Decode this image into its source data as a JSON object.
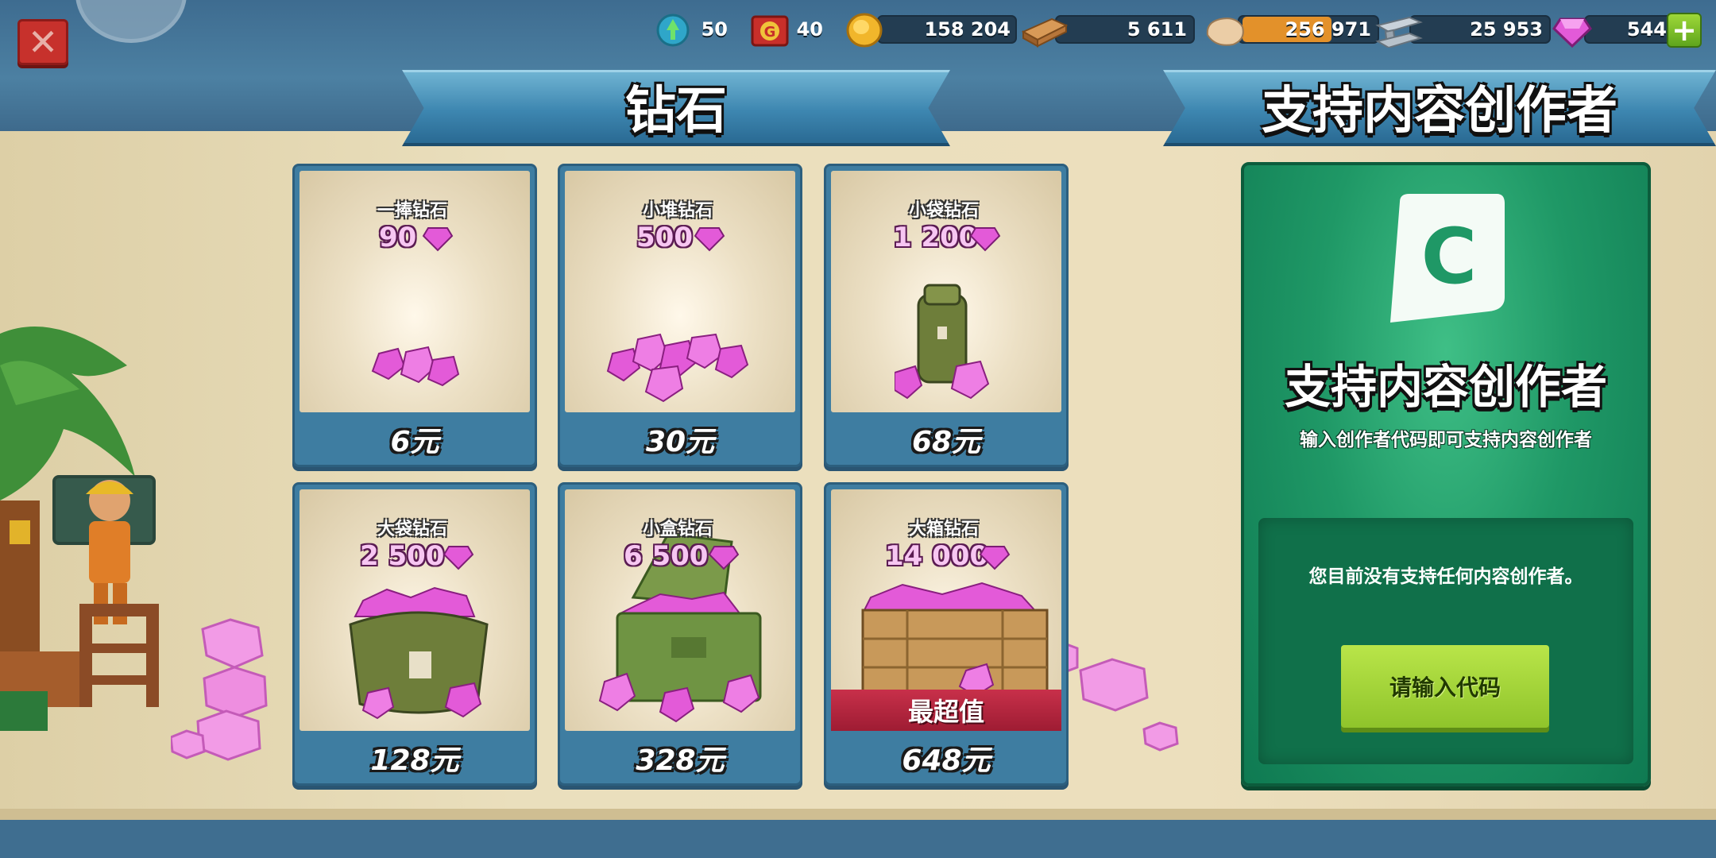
{
  "header": {
    "close_glyph": "✕",
    "resources": [
      {
        "name": "skill-token",
        "value": "50",
        "color": "#2fa6c9"
      },
      {
        "name": "gold-token",
        "value": "40",
        "color": "#d8a21f"
      },
      {
        "name": "gold",
        "value": "158 204",
        "color": "#f1b62b"
      },
      {
        "name": "wood",
        "value": "5 611",
        "color": "#c88a4a"
      },
      {
        "name": "stone",
        "value": "256 971",
        "color": "#e8c8a0"
      },
      {
        "name": "iron",
        "value": "25 953",
        "color": "#a8b4bf"
      },
      {
        "name": "diamonds",
        "value": "544",
        "color": "#d94ad0"
      }
    ],
    "add_glyph": "+"
  },
  "diamonds_section": {
    "title": "钻石",
    "packs": [
      {
        "name": "一捧钻石",
        "amount": "90",
        "price": "6元"
      },
      {
        "name": "小堆钻石",
        "amount": "500",
        "price": "30元"
      },
      {
        "name": "小袋钻石",
        "amount": "1 200",
        "price": "68元"
      },
      {
        "name": "大袋钻石",
        "amount": "2 500",
        "price": "128元"
      },
      {
        "name": "小盒钻石",
        "amount": "6 500",
        "price": "328元"
      },
      {
        "name": "大箱钻石",
        "amount": "14 000",
        "price": "648元",
        "badge": "最超值"
      }
    ]
  },
  "creator_section": {
    "title": "支持内容创作者",
    "logo_letter": "C",
    "heading": "支持内容创作者",
    "subtitle": "输入创作者代码即可支持内容创作者",
    "status": "您目前没有支持任何内容创作者。",
    "button_label": "请输入代码"
  },
  "colors": {
    "diamond_pink": "#e35ad8",
    "panel_green": "#1f9866",
    "button_green": "#a4d53a",
    "card_blue": "#3e7da1",
    "best_value_red": "#b5253a"
  }
}
